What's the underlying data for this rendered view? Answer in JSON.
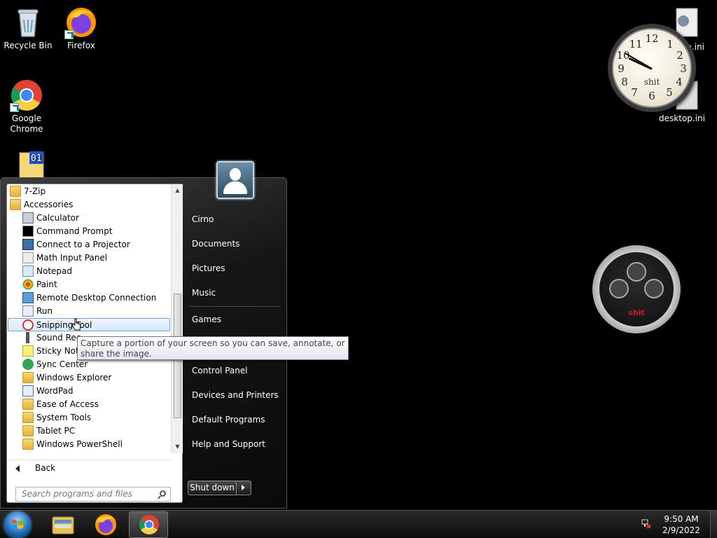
{
  "desktop": {
    "icons": [
      {
        "label": "Recycle Bin"
      },
      {
        "label": "Firefox"
      },
      {
        "label": "Google Chrome"
      },
      {
        "label": "desktop.ini"
      },
      {
        "label": "desktop.ini"
      }
    ],
    "clock_gadget": {
      "numbers": [
        "12",
        "1",
        "2",
        "3",
        "4",
        "5",
        "6",
        "7",
        "8",
        "9",
        "10",
        "11"
      ],
      "label": "shit"
    },
    "chrono_gadget": {
      "label": "shit"
    }
  },
  "start_menu": {
    "programs": [
      {
        "label": "7-Zip",
        "icon": "folder-icon"
      },
      {
        "label": "Accessories",
        "icon": "folder-icon"
      },
      {
        "label": "Calculator",
        "icon": "calculator-icon"
      },
      {
        "label": "Command Prompt",
        "icon": "command-prompt-icon"
      },
      {
        "label": "Connect to a Projector",
        "icon": "projector-icon"
      },
      {
        "label": "Math Input Panel",
        "icon": "math-input-icon"
      },
      {
        "label": "Notepad",
        "icon": "notepad-icon"
      },
      {
        "label": "Paint",
        "icon": "paint-icon"
      },
      {
        "label": "Remote Desktop Connection",
        "icon": "remote-desktop-icon"
      },
      {
        "label": "Run",
        "icon": "run-icon"
      },
      {
        "label": "Snipping Tool",
        "icon": "snipping-tool-icon"
      },
      {
        "label": "Sound Rec",
        "icon": "microphone-icon"
      },
      {
        "label": "Sticky Note",
        "icon": "sticky-notes-icon"
      },
      {
        "label": "Sync Center",
        "icon": "sync-center-icon"
      },
      {
        "label": "Windows Explorer",
        "icon": "explorer-icon"
      },
      {
        "label": "WordPad",
        "icon": "wordpad-icon"
      },
      {
        "label": "Ease of Access",
        "icon": "folder-icon"
      },
      {
        "label": "System Tools",
        "icon": "folder-icon"
      },
      {
        "label": "Tablet PC",
        "icon": "folder-icon"
      },
      {
        "label": "Windows PowerShell",
        "icon": "folder-icon"
      }
    ],
    "back_label": "Back",
    "search_placeholder": "Search programs and files",
    "right_items": {
      "user": "Cirno",
      "documents": "Documents",
      "pictures": "Pictures",
      "music": "Music",
      "games": "Games",
      "control_panel": "Control Panel",
      "devices": "Devices and Printers",
      "default_programs": "Default Programs",
      "help": "Help and Support"
    },
    "shutdown_label": "Shut down",
    "tooltip": "Capture a portion of your screen so you can save, annotate, or share the image."
  },
  "taskbar": {
    "time": "9:50 AM",
    "date": "2/9/2022"
  },
  "colors": {
    "selection": "#d8e8fa",
    "accent": "#1b66b5"
  }
}
